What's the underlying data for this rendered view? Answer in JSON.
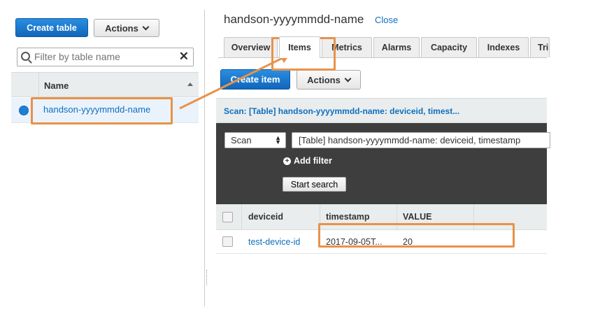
{
  "left_panel": {
    "create_table_label": "Create table",
    "actions_label": "Actions",
    "filter_placeholder": "Filter by table name",
    "clear_symbol": "✕",
    "column_header": "Name",
    "tables": [
      {
        "name": "handson-yyyymmdd-name",
        "selected": true
      }
    ]
  },
  "detail": {
    "title": "handson-yyyymmdd-name",
    "close_label": "Close",
    "tabs": [
      {
        "label": "Overview",
        "active": false
      },
      {
        "label": "Items",
        "active": true
      },
      {
        "label": "Metrics",
        "active": false
      },
      {
        "label": "Alarms",
        "active": false
      },
      {
        "label": "Capacity",
        "active": false
      },
      {
        "label": "Indexes",
        "active": false
      },
      {
        "label": "Tri",
        "active": false
      }
    ],
    "create_item_label": "Create item",
    "actions_label": "Actions",
    "scan_title": "Scan: [Table] handson-yyyymmdd-name: deviceid, timest...",
    "scan_mode": "Scan",
    "scan_target": "[Table] handson-yyyymmdd-name: deviceid, timestamp",
    "add_filter_label": "Add filter",
    "start_search_label": "Start search",
    "columns": [
      "deviceid",
      "timestamp",
      "VALUE"
    ],
    "rows": [
      {
        "deviceid": "test-device-id",
        "timestamp": "2017-09-05T...",
        "value": "20"
      }
    ]
  },
  "colors": {
    "accent_blue": "#1b7fd8",
    "link_blue": "#0e6fbf",
    "annotation_orange": "#e8924a",
    "dark_panel": "#3e3e3e"
  }
}
